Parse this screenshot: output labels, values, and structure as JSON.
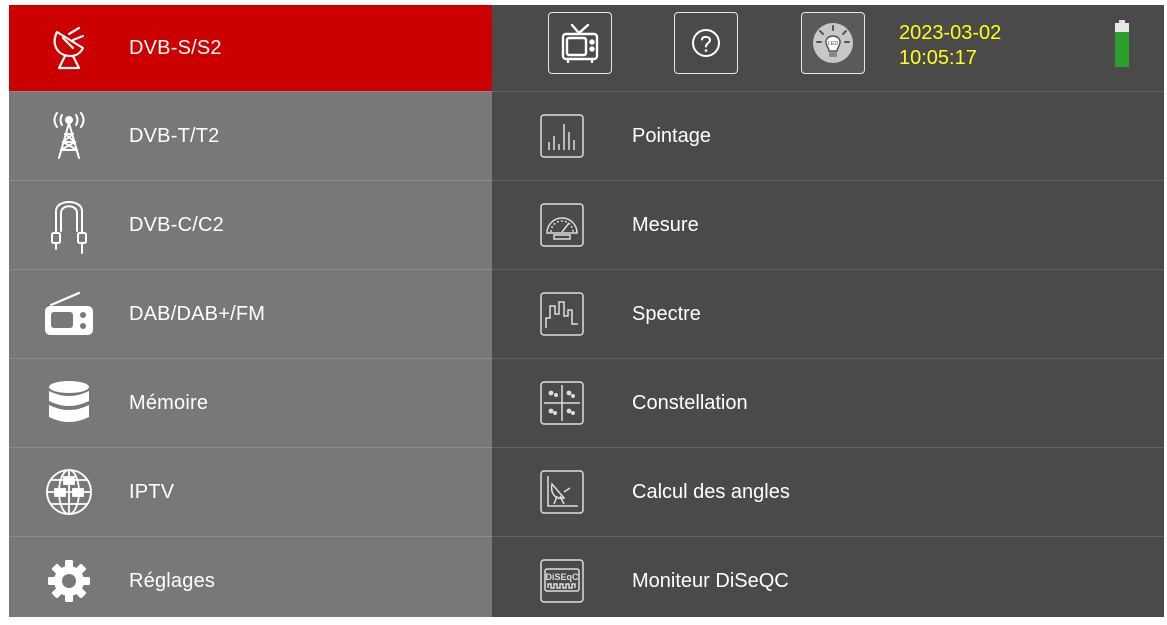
{
  "sidebar": {
    "items": [
      {
        "label": "DVB-S/S2",
        "icon": "satellite-dish-icon",
        "active": true
      },
      {
        "label": "DVB-T/T2",
        "icon": "antenna-tower-icon"
      },
      {
        "label": "DVB-C/C2",
        "icon": "coax-cable-icon"
      },
      {
        "label": "DAB/DAB+/FM",
        "icon": "radio-icon"
      },
      {
        "label": "Mémoire",
        "icon": "database-icon"
      },
      {
        "label": "IPTV",
        "icon": "globe-network-icon"
      },
      {
        "label": "Réglages",
        "icon": "gear-icon"
      }
    ]
  },
  "header": {
    "date": "2023-03-02",
    "time": "10:05:17",
    "buttons": [
      "tv-icon",
      "help-icon",
      "led-bulb-icon"
    ],
    "led_label": "LED",
    "battery_level": 0.8
  },
  "menu": {
    "items": [
      {
        "label": "Pointage",
        "icon": "signal-bars-icon"
      },
      {
        "label": "Mesure",
        "icon": "gauge-icon"
      },
      {
        "label": "Spectre",
        "icon": "spectrum-icon"
      },
      {
        "label": "Constellation",
        "icon": "constellation-icon"
      },
      {
        "label": "Calcul des angles",
        "icon": "angle-dish-icon"
      },
      {
        "label": "Moniteur DiSeQC",
        "icon": "diseqc-icon",
        "icon_text": "DiSEqC"
      }
    ]
  },
  "colors": {
    "active": "#cc0000",
    "left_bg": "#787878",
    "right_bg": "#4a4a4a",
    "datetime": "#ffff1a",
    "battery": "#2aa02a"
  }
}
